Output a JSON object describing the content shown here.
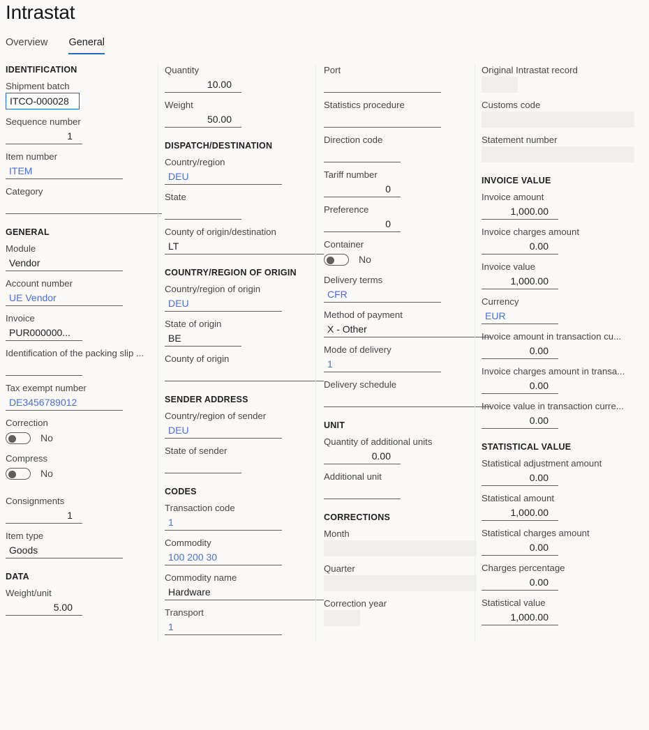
{
  "header": {
    "title": "Intrastat",
    "tabs": [
      {
        "label": "Overview",
        "active": false
      },
      {
        "label": "General",
        "active": true
      }
    ],
    "accent_color": "#2266cc"
  },
  "col1": {
    "identification_head": "IDENTIFICATION",
    "shipment_batch_label": "Shipment batch",
    "shipment_batch_value": "ITCO-000028",
    "sequence_number_label": "Sequence number",
    "sequence_number_value": "1",
    "item_number_label": "Item number",
    "item_number_value": "ITEM",
    "category_label": "Category",
    "category_value": "",
    "general_head": "GENERAL",
    "module_label": "Module",
    "module_value": "Vendor",
    "account_number_label": "Account number",
    "account_number_value": "UE Vendor",
    "invoice_label": "Invoice",
    "invoice_value": "PUR000000...",
    "packing_slip_label": "Identification of the packing slip ...",
    "packing_slip_value": "",
    "tax_exempt_label": "Tax exempt number",
    "tax_exempt_value": "DE3456789012",
    "correction_label": "Correction",
    "correction_value": "No",
    "compress_label": "Compress",
    "compress_value": "No",
    "consignments_label": "Consignments",
    "consignments_value": "1",
    "item_type_label": "Item type",
    "item_type_value": "Goods",
    "data_head": "DATA",
    "weight_unit_label": "Weight/unit",
    "weight_unit_value": "5.00"
  },
  "col2": {
    "quantity_label": "Quantity",
    "quantity_value": "10.00",
    "weight_label": "Weight",
    "weight_value": "50.00",
    "dispatch_head": "DISPATCH/DESTINATION",
    "country_region_label": "Country/region",
    "country_region_value": "DEU",
    "state_label": "State",
    "state_value": "",
    "county_orig_dest_label": "County of origin/destination",
    "county_orig_dest_value": "LT",
    "origin_head": "COUNTRY/REGION OF ORIGIN",
    "country_of_origin_label": "Country/region of origin",
    "country_of_origin_value": "DEU",
    "state_of_origin_label": "State of origin",
    "state_of_origin_value": "BE",
    "county_of_origin_label": "County of origin",
    "county_of_origin_value": "",
    "sender_head": "SENDER ADDRESS",
    "country_of_sender_label": "Country/region of sender",
    "country_of_sender_value": "DEU",
    "state_of_sender_label": "State of sender",
    "state_of_sender_value": "",
    "codes_head": "CODES",
    "transaction_code_label": "Transaction code",
    "transaction_code_value": "1",
    "commodity_label": "Commodity",
    "commodity_value": "100 200 30",
    "commodity_name_label": "Commodity name",
    "commodity_name_value": "Hardware",
    "transport_label": "Transport",
    "transport_value": "1"
  },
  "col3": {
    "port_label": "Port",
    "port_value": "",
    "statistics_procedure_label": "Statistics procedure",
    "statistics_procedure_value": "",
    "direction_code_label": "Direction code",
    "direction_code_value": "",
    "tariff_number_label": "Tariff number",
    "tariff_number_value": "0",
    "preference_label": "Preference",
    "preference_value": "0",
    "container_label": "Container",
    "container_value": "No",
    "delivery_terms_label": "Delivery terms",
    "delivery_terms_value": "CFR",
    "method_of_payment_label": "Method of payment",
    "method_of_payment_value": "X - Other",
    "mode_of_delivery_label": "Mode of delivery",
    "mode_of_delivery_value": "1",
    "delivery_schedule_label": "Delivery schedule",
    "delivery_schedule_value": "",
    "unit_head": "UNIT",
    "qty_additional_units_label": "Quantity of additional units",
    "qty_additional_units_value": "0.00",
    "additional_unit_label": "Additional unit",
    "additional_unit_value": "",
    "corrections_head": "CORRECTIONS",
    "month_label": "Month",
    "quarter_label": "Quarter",
    "correction_year_label": "Correction year"
  },
  "col4": {
    "original_record_label": "Original Intrastat record",
    "customs_code_label": "Customs code",
    "statement_number_label": "Statement number",
    "invoice_value_head": "INVOICE VALUE",
    "invoice_amount_label": "Invoice amount",
    "invoice_amount_value": "1,000.00",
    "invoice_charges_amount_label": "Invoice charges amount",
    "invoice_charges_amount_value": "0.00",
    "invoice_value_label": "Invoice value",
    "invoice_value_value": "1,000.00",
    "currency_label": "Currency",
    "currency_value": "EUR",
    "invoice_amount_txn_label": "Invoice amount in transaction cu...",
    "invoice_amount_txn_value": "0.00",
    "invoice_charges_txn_label": "Invoice charges amount in transa...",
    "invoice_charges_txn_value": "0.00",
    "invoice_value_txn_label": "Invoice value in transaction curre...",
    "invoice_value_txn_value": "0.00",
    "statistical_value_head": "STATISTICAL VALUE",
    "stat_adjustment_label": "Statistical adjustment amount",
    "stat_adjustment_value": "0.00",
    "stat_amount_label": "Statistical amount",
    "stat_amount_value": "1,000.00",
    "stat_charges_label": "Statistical charges amount",
    "stat_charges_value": "0.00",
    "charges_percentage_label": "Charges percentage",
    "charges_percentage_value": "0.00",
    "statistical_value_label": "Statistical value",
    "statistical_value_value": "1,000.00"
  }
}
